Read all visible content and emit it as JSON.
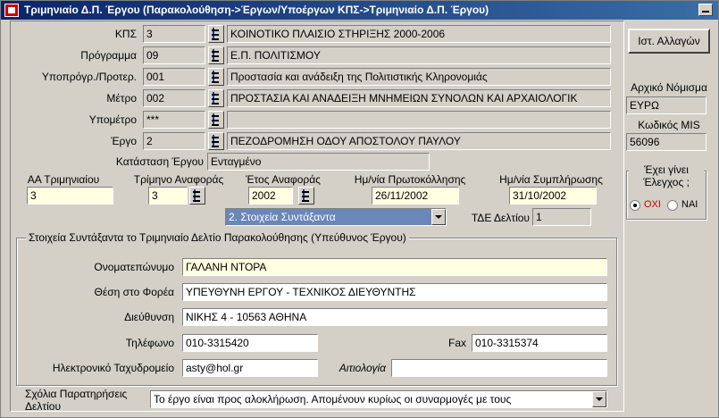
{
  "window": {
    "title": "Τριμηνιαίο Δ.Π. Έργου (Παρακολούθηση->Έργων/Υποέργων ΚΠΣ->Τριμηνιαίο Δ.Π. Έργου)"
  },
  "project": {
    "kps": {
      "label": "ΚΠΣ",
      "code": "3",
      "name": "ΚΟΙΝΟΤΙΚΟ ΠΛΑΙΣΙΟ ΣΤΗΡΙΞΗΣ 2000-2006"
    },
    "programma": {
      "label": "Πρόγραμμα",
      "code": "09",
      "name": "Ε.Π. ΠΟΛΙΤΙΣΜΟΥ"
    },
    "ypoprogramma": {
      "label": "Υποπρόγρ./Προτερ.",
      "code": "001",
      "name": "Προστασία και ανάδειξη της Πολιτιστικής Κληρονομιάς"
    },
    "metro": {
      "label": "Μέτρο",
      "code": "002",
      "name": "ΠΡΟΣΤΑΣΙΑ ΚΑΙ ΑΝΑΔΕΙΞΗ ΜΝΗΜΕΙΩΝ ΣΥΝΟΛΩΝ ΚΑΙ ΑΡΧΑΙΟΛΟΓΙΚ"
    },
    "ypometro": {
      "label": "Υπομέτρο",
      "code": "***",
      "name": ""
    },
    "ergo": {
      "label": "Έργο",
      "code": "2",
      "name": "ΠΕΖΟΔΡΟΜΗΣΗ ΟΔΟΥ ΑΠΟΣΤΟΛΟΥ ΠΑΥΛΟΥ"
    },
    "katastasi": {
      "label": "Κατάσταση Έργου",
      "value": "Ενταγμένο"
    }
  },
  "quarter": {
    "aa_label": "ΑΑ Τριμηνιαίου",
    "aa_value": "3",
    "trimino_label": "Τρίμηνο Αναφοράς",
    "trimino_value": "3",
    "etos_label": "Έτος Αναφοράς",
    "etos_value": "2002",
    "protokollisi_label": "Ημ/νία Πρωτοκόλλησης",
    "protokollisi_value": "26/11/2002",
    "symplirosi_label": "Ημ/νία Συμπλήρωσης",
    "symplirosi_value": "31/10/2002"
  },
  "section": {
    "selected": "2. Στοιχεία Συντάξαντα",
    "tde_label": "ΤΔΕ Δελτίου",
    "tde_value": "1"
  },
  "author": {
    "group_title": "Στοιχεία Συντάξαντα το Τριμηνιαίο Δελτίο Παρακολούθησης (Υπεύθυνος Έργου)",
    "name_label": "Ονοματεπώνυμο",
    "name_value": "ΓΑΛΑΝΗ ΝΤΟΡΑ",
    "position_label": "Θέση στο Φορέα",
    "position_value": "ΥΠΕΥΘΥΝΗ ΕΡΓΟΥ - ΤΕΧΝΙΚΟΣ ΔΙΕΥΘΥΝΤΗΣ",
    "address_label": "Διεύθυνση",
    "address_value": "ΝΙΚΗΣ 4 - 10563 ΑΘΗΝΑ",
    "phone_label": "Τηλέφωνο",
    "phone_value": "010-3315420",
    "fax_label": "Fax",
    "fax_value": "010-3315374",
    "email_label": "Ηλεκτρονικό Ταχυδρομείο",
    "email_value": "asty@hol.gr",
    "reason_label": "Αιτιολογία",
    "reason_value": ""
  },
  "comments": {
    "label": "Σχόλια Παρατηρήσεις Δελτίου",
    "value": "Το έργο είναι προς αλοκλήρωση. Απομένουν κυρίως οι συναρμογές με τους"
  },
  "right": {
    "history_button": "Ιστ. Αλλαγών",
    "currency_label": "Αρχικό Νόμισμα",
    "currency_value": "ΕΥΡΩ",
    "mis_label": "Κωδικός MIS",
    "mis_value": "56096",
    "checked_title": "Έχει γίνει Έλεγχος ;",
    "option_no": "ΟΧΙ",
    "option_yes": "ΝΑΙ"
  }
}
